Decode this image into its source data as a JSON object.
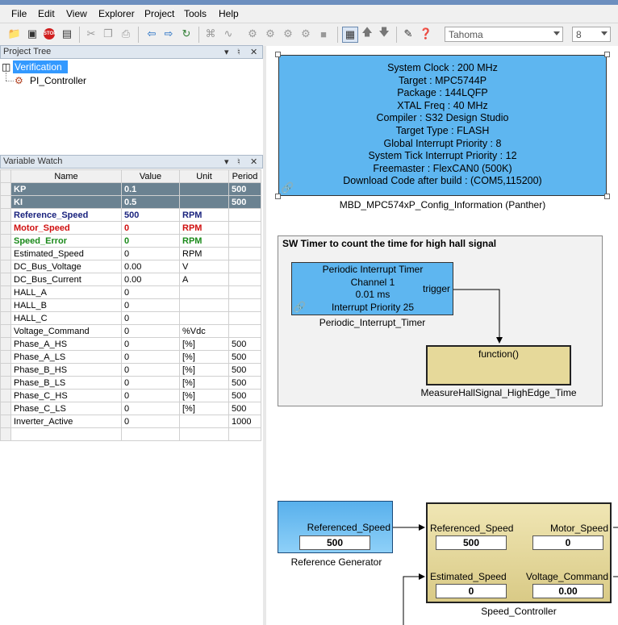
{
  "menu": [
    "File",
    "Edit",
    "View",
    "Explorer",
    "Project",
    "Tools",
    "Help"
  ],
  "toolbar": {
    "font_name": "Tahoma",
    "font_size": "8"
  },
  "project_tree": {
    "title": "Project Tree",
    "root": "Verification",
    "child": "PI_Controller"
  },
  "variable_watch": {
    "title": "Variable Watch",
    "columns": [
      "Name",
      "Value",
      "Unit",
      "Period"
    ],
    "rows": [
      {
        "name": "KP",
        "value": "0.1",
        "unit": "",
        "period": "500",
        "style": "hl"
      },
      {
        "name": "KI",
        "value": "0.5",
        "unit": "",
        "period": "500",
        "style": "hl"
      },
      {
        "name": "Reference_Speed",
        "value": "500",
        "unit": "RPM",
        "period": "",
        "style": "blue"
      },
      {
        "name": "Motor_Speed",
        "value": "0",
        "unit": "RPM",
        "period": "",
        "style": "red"
      },
      {
        "name": "Speed_Error",
        "value": "0",
        "unit": "RPM",
        "period": "",
        "style": "green"
      },
      {
        "name": "Estimated_Speed",
        "value": "0",
        "unit": "RPM",
        "period": "",
        "style": ""
      },
      {
        "name": "DC_Bus_Voltage",
        "value": "0.00",
        "unit": "V",
        "period": "",
        "style": ""
      },
      {
        "name": "DC_Bus_Current",
        "value": "0.00",
        "unit": "A",
        "period": "",
        "style": ""
      },
      {
        "name": "HALL_A",
        "value": "0",
        "unit": "",
        "period": "",
        "style": ""
      },
      {
        "name": "HALL_B",
        "value": "0",
        "unit": "",
        "period": "",
        "style": ""
      },
      {
        "name": "HALL_C",
        "value": "0",
        "unit": "",
        "period": "",
        "style": ""
      },
      {
        "name": "Voltage_Command",
        "value": "0",
        "unit": "%Vdc",
        "period": "",
        "style": ""
      },
      {
        "name": "Phase_A_HS",
        "value": "0",
        "unit": "[%]",
        "period": "500",
        "style": ""
      },
      {
        "name": "Phase_A_LS",
        "value": "0",
        "unit": "[%]",
        "period": "500",
        "style": ""
      },
      {
        "name": "Phase_B_HS",
        "value": "0",
        "unit": "[%]",
        "period": "500",
        "style": ""
      },
      {
        "name": "Phase_B_LS",
        "value": "0",
        "unit": "[%]",
        "period": "500",
        "style": ""
      },
      {
        "name": "Phase_C_HS",
        "value": "0",
        "unit": "[%]",
        "period": "500",
        "style": ""
      },
      {
        "name": "Phase_C_LS",
        "value": "0",
        "unit": "[%]",
        "period": "500",
        "style": ""
      },
      {
        "name": "Inverter_Active",
        "value": "0",
        "unit": "",
        "period": "1000",
        "style": ""
      },
      {
        "name": "",
        "value": "",
        "unit": "",
        "period": "",
        "style": ""
      }
    ]
  },
  "config_block": {
    "lines": [
      "System Clock : 200 MHz",
      "Target : MPC5744P",
      "Package : 144LQFP",
      "XTAL Freq : 40 MHz",
      "Compiler : S32 Design Studio",
      "Target Type : FLASH",
      "Global Interrupt Priority : 8",
      "System Tick Interrupt Priority : 12",
      "Freemaster : FlexCAN0 (500K)",
      "Download Code after build : (COM5,115200)"
    ],
    "caption": "MBD_MPC574xP_Config_Information (Panther)"
  },
  "timer_area": {
    "title": "SW Timer to count the time for high hall signal",
    "pit_lines": [
      "Periodic Interrupt Timer",
      "Channel 1",
      "0.01 ms",
      "Interrupt Priority 25"
    ],
    "pit_port": "trigger",
    "pit_caption": "Periodic_Interrupt_Timer",
    "func_label": "function()",
    "func_caption": "MeasureHallSignal_HighEdge_Time"
  },
  "ref_gen": {
    "port": "Referenced_Speed",
    "value": "500",
    "caption": "Reference Generator"
  },
  "speed_ctrl": {
    "in1": "Referenced_Speed",
    "in1_value": "500",
    "out1": "Motor_Speed",
    "out1_value": "0",
    "in2": "Estimated_Speed",
    "in2_value": "0",
    "out2": "Voltage_Command",
    "out2_value": "0.00",
    "caption": "Speed_Controller"
  }
}
